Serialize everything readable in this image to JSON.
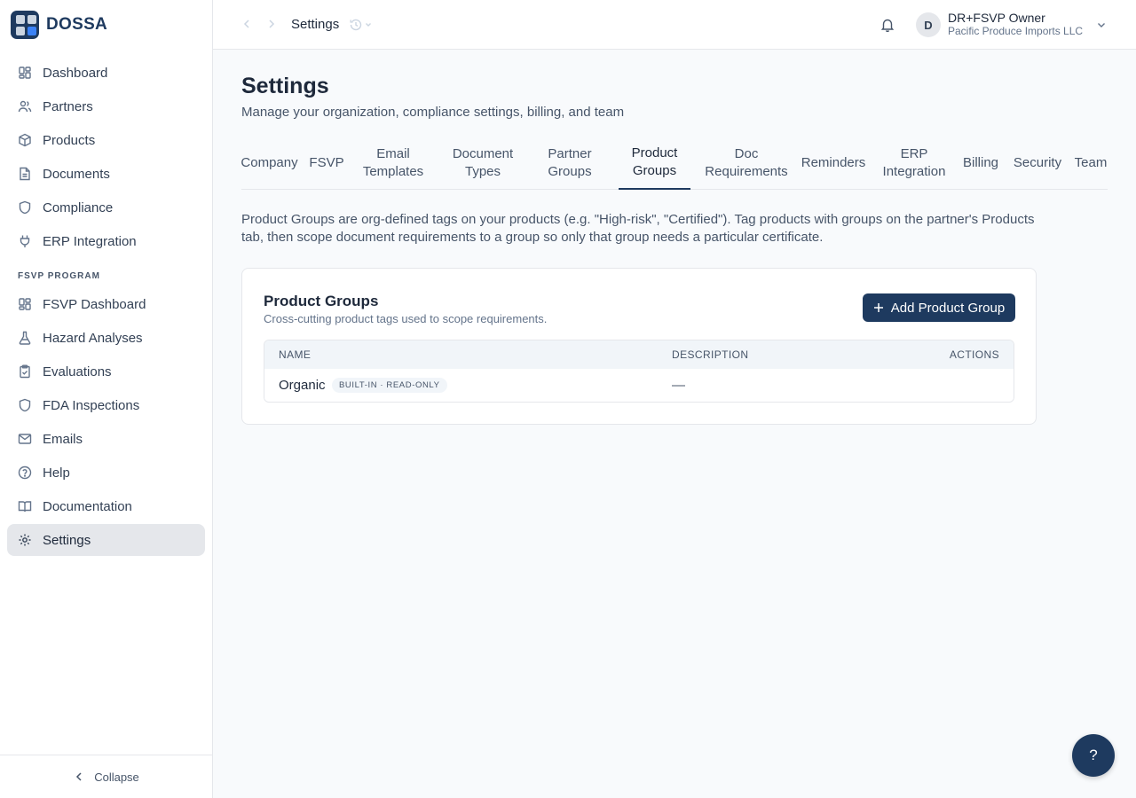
{
  "brand": {
    "name": "DOSSA"
  },
  "sidebar": {
    "items": [
      {
        "label": "Dashboard",
        "icon": "grid-icon"
      },
      {
        "label": "Partners",
        "icon": "users-icon"
      },
      {
        "label": "Products",
        "icon": "box-icon"
      },
      {
        "label": "Documents",
        "icon": "file-icon"
      },
      {
        "label": "Compliance",
        "icon": "shield-icon"
      },
      {
        "label": "ERP Integration",
        "icon": "plug-icon"
      }
    ],
    "section_label": "FSVP PROGRAM",
    "fsvp_items": [
      {
        "label": "FSVP Dashboard",
        "icon": "grid-icon"
      },
      {
        "label": "Hazard Analyses",
        "icon": "flask-icon"
      },
      {
        "label": "Evaluations",
        "icon": "clipboard-icon"
      },
      {
        "label": "FDA Inspections",
        "icon": "shield-icon"
      },
      {
        "label": "Emails",
        "icon": "mail-icon"
      },
      {
        "label": "Help",
        "icon": "help-circle-icon"
      },
      {
        "label": "Documentation",
        "icon": "book-icon"
      },
      {
        "label": "Settings",
        "icon": "gear-icon",
        "active": true
      }
    ],
    "collapse_label": "Collapse"
  },
  "topbar": {
    "title": "Settings",
    "user": {
      "initial": "D",
      "name": "DR+FSVP Owner",
      "org": "Pacific Produce Imports LLC"
    }
  },
  "page": {
    "title": "Settings",
    "subtitle": "Manage your organization, compliance settings, billing, and team",
    "tabs": [
      {
        "line1": "Company",
        "line2": ""
      },
      {
        "line1": "FSVP",
        "line2": ""
      },
      {
        "line1": "Email",
        "line2": "Templates"
      },
      {
        "line1": "Document",
        "line2": "Types"
      },
      {
        "line1": "Partner",
        "line2": "Groups"
      },
      {
        "line1": "Product",
        "line2": "Groups",
        "active": true
      },
      {
        "line1": "Doc",
        "line2": "Requirements"
      },
      {
        "line1": "Reminders",
        "line2": ""
      },
      {
        "line1": "ERP",
        "line2": "Integration"
      },
      {
        "line1": "Billing",
        "line2": ""
      },
      {
        "line1": "Security",
        "line2": ""
      },
      {
        "line1": "Team",
        "line2": ""
      }
    ],
    "intro": "Product Groups are org-defined tags on your products (e.g. \"High-risk\", \"Certified\"). Tag products with groups on the partner's Products tab, then scope document requirements to a group so only that group needs a particular certificate."
  },
  "card": {
    "title": "Product Groups",
    "subtitle": "Cross-cutting product tags used to scope requirements.",
    "add_button": "Add Product Group",
    "columns": {
      "name": "NAME",
      "description": "DESCRIPTION",
      "actions": "ACTIONS"
    },
    "rows": [
      {
        "name": "Organic",
        "badge": "BUILT-IN · READ-ONLY",
        "description": "—"
      }
    ]
  },
  "help_fab": "?",
  "colors": {
    "brand": "#1e3a5f",
    "active_nav": "#e5e7eb",
    "border": "#e5e7eb"
  }
}
